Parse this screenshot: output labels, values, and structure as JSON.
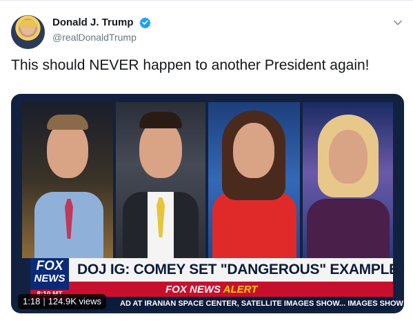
{
  "tweet": {
    "author": {
      "display_name": "Donald J. Trump",
      "handle": "@realDonaldTrump",
      "verified": true
    },
    "text": "This should NEVER happen to another President again!"
  },
  "media": {
    "type": "video",
    "broadcast": {
      "logo_line1": "FOX",
      "logo_line2": "NEWS",
      "logo_time": "8:10 MT",
      "headline": "DOJ IG: COMEY SET \"DANGEROUS\" EXAMPLE FOR FBI",
      "alert_brand": "FOX NEWS",
      "alert_word": "ALERT",
      "ticker": "AD AT IRANIAN SPACE CENTER, SATELLITE IMAGES SHOW... IMAGES SHOW BLACK"
    },
    "duration": "1:18",
    "views": "124.9K views"
  },
  "colors": {
    "verified": "#1da1f2",
    "text_primary": "#14171a",
    "text_secondary": "#657786",
    "fox_blue": "#0a2a78",
    "fox_red": "#c8102e"
  },
  "icons": {
    "verified": "verified-badge-icon",
    "menu": "chevron-down-icon"
  }
}
